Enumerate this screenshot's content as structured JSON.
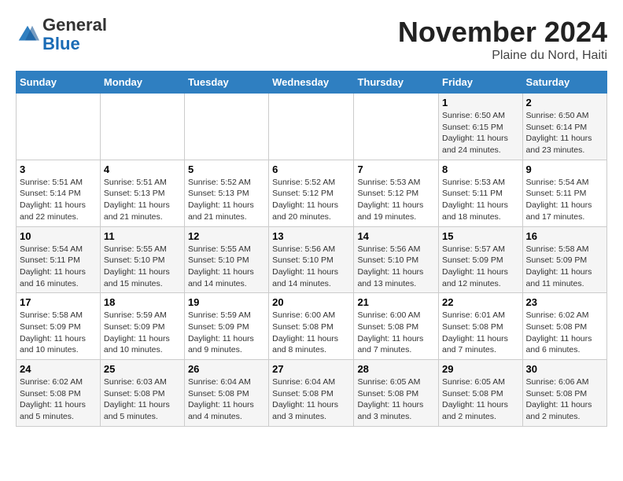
{
  "header": {
    "logo_general": "General",
    "logo_blue": "Blue",
    "month": "November 2024",
    "location": "Plaine du Nord, Haiti"
  },
  "weekdays": [
    "Sunday",
    "Monday",
    "Tuesday",
    "Wednesday",
    "Thursday",
    "Friday",
    "Saturday"
  ],
  "weeks": [
    [
      {
        "day": "",
        "info": ""
      },
      {
        "day": "",
        "info": ""
      },
      {
        "day": "",
        "info": ""
      },
      {
        "day": "",
        "info": ""
      },
      {
        "day": "",
        "info": ""
      },
      {
        "day": "1",
        "info": "Sunrise: 6:50 AM\nSunset: 6:15 PM\nDaylight: 11 hours and 24 minutes."
      },
      {
        "day": "2",
        "info": "Sunrise: 6:50 AM\nSunset: 6:14 PM\nDaylight: 11 hours and 23 minutes."
      }
    ],
    [
      {
        "day": "3",
        "info": "Sunrise: 5:51 AM\nSunset: 5:14 PM\nDaylight: 11 hours and 22 minutes."
      },
      {
        "day": "4",
        "info": "Sunrise: 5:51 AM\nSunset: 5:13 PM\nDaylight: 11 hours and 21 minutes."
      },
      {
        "day": "5",
        "info": "Sunrise: 5:52 AM\nSunset: 5:13 PM\nDaylight: 11 hours and 21 minutes."
      },
      {
        "day": "6",
        "info": "Sunrise: 5:52 AM\nSunset: 5:12 PM\nDaylight: 11 hours and 20 minutes."
      },
      {
        "day": "7",
        "info": "Sunrise: 5:53 AM\nSunset: 5:12 PM\nDaylight: 11 hours and 19 minutes."
      },
      {
        "day": "8",
        "info": "Sunrise: 5:53 AM\nSunset: 5:11 PM\nDaylight: 11 hours and 18 minutes."
      },
      {
        "day": "9",
        "info": "Sunrise: 5:54 AM\nSunset: 5:11 PM\nDaylight: 11 hours and 17 minutes."
      }
    ],
    [
      {
        "day": "10",
        "info": "Sunrise: 5:54 AM\nSunset: 5:11 PM\nDaylight: 11 hours and 16 minutes."
      },
      {
        "day": "11",
        "info": "Sunrise: 5:55 AM\nSunset: 5:10 PM\nDaylight: 11 hours and 15 minutes."
      },
      {
        "day": "12",
        "info": "Sunrise: 5:55 AM\nSunset: 5:10 PM\nDaylight: 11 hours and 14 minutes."
      },
      {
        "day": "13",
        "info": "Sunrise: 5:56 AM\nSunset: 5:10 PM\nDaylight: 11 hours and 14 minutes."
      },
      {
        "day": "14",
        "info": "Sunrise: 5:56 AM\nSunset: 5:10 PM\nDaylight: 11 hours and 13 minutes."
      },
      {
        "day": "15",
        "info": "Sunrise: 5:57 AM\nSunset: 5:09 PM\nDaylight: 11 hours and 12 minutes."
      },
      {
        "day": "16",
        "info": "Sunrise: 5:58 AM\nSunset: 5:09 PM\nDaylight: 11 hours and 11 minutes."
      }
    ],
    [
      {
        "day": "17",
        "info": "Sunrise: 5:58 AM\nSunset: 5:09 PM\nDaylight: 11 hours and 10 minutes."
      },
      {
        "day": "18",
        "info": "Sunrise: 5:59 AM\nSunset: 5:09 PM\nDaylight: 11 hours and 10 minutes."
      },
      {
        "day": "19",
        "info": "Sunrise: 5:59 AM\nSunset: 5:09 PM\nDaylight: 11 hours and 9 minutes."
      },
      {
        "day": "20",
        "info": "Sunrise: 6:00 AM\nSunset: 5:08 PM\nDaylight: 11 hours and 8 minutes."
      },
      {
        "day": "21",
        "info": "Sunrise: 6:00 AM\nSunset: 5:08 PM\nDaylight: 11 hours and 7 minutes."
      },
      {
        "day": "22",
        "info": "Sunrise: 6:01 AM\nSunset: 5:08 PM\nDaylight: 11 hours and 7 minutes."
      },
      {
        "day": "23",
        "info": "Sunrise: 6:02 AM\nSunset: 5:08 PM\nDaylight: 11 hours and 6 minutes."
      }
    ],
    [
      {
        "day": "24",
        "info": "Sunrise: 6:02 AM\nSunset: 5:08 PM\nDaylight: 11 hours and 5 minutes."
      },
      {
        "day": "25",
        "info": "Sunrise: 6:03 AM\nSunset: 5:08 PM\nDaylight: 11 hours and 5 minutes."
      },
      {
        "day": "26",
        "info": "Sunrise: 6:04 AM\nSunset: 5:08 PM\nDaylight: 11 hours and 4 minutes."
      },
      {
        "day": "27",
        "info": "Sunrise: 6:04 AM\nSunset: 5:08 PM\nDaylight: 11 hours and 3 minutes."
      },
      {
        "day": "28",
        "info": "Sunrise: 6:05 AM\nSunset: 5:08 PM\nDaylight: 11 hours and 3 minutes."
      },
      {
        "day": "29",
        "info": "Sunrise: 6:05 AM\nSunset: 5:08 PM\nDaylight: 11 hours and 2 minutes."
      },
      {
        "day": "30",
        "info": "Sunrise: 6:06 AM\nSunset: 5:08 PM\nDaylight: 11 hours and 2 minutes."
      }
    ]
  ]
}
